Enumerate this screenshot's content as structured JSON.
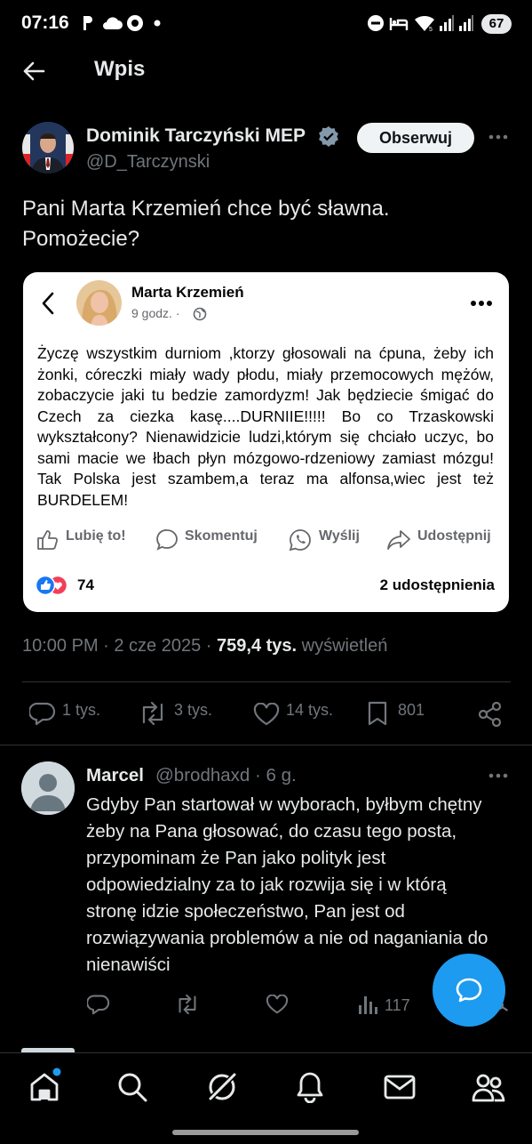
{
  "status_bar": {
    "time": "07:16",
    "battery": "67",
    "icons": [
      "p-icon",
      "cloud-icon",
      "chrome-icon",
      "dot-icon",
      "dnd-icon",
      "bed-icon",
      "wifi-icon",
      "signal-icon",
      "signal2-icon"
    ]
  },
  "header": {
    "title": "Wpis"
  },
  "post": {
    "author_name": "Dominik Tarczyński MEP",
    "author_handle": "@D_Tarczynski",
    "follow_label": "Obserwuj",
    "text_line1": "Pani Marta Krzemień chce być sławna.",
    "text_line2": "Pomożecie?",
    "timestamp": "10:00 PM · 2 cze 2025 · ",
    "views_count": "759,4 tys.",
    "views_label": " wyświetleń"
  },
  "embedded_card": {
    "author_name": "Marta Krzemień",
    "time": "9 godz. ·",
    "body": "Życzę wszystkim durniom ,ktorzy głosowali na ćpuna, żeby ich żonki, córeczki miały wady płodu, miały przemocowych mężów, zobaczycie jaki tu bedzie zamordyzm! Jak będziecie śmigać do Czech za ciezka kasę....DURNIIE!!!!! Bo co Trzaskowski wykształcony? Nienawidzicie ludzi,którym się chciało uczyc, bo sami macie we łbach płyn mózgowo-rdzeniowy zamiast mózgu! Tak Polska jest szambem,a teraz ma alfonsa,wiec jest też BURDELEM!",
    "actions": [
      "Lubię to!",
      "Skomentuj",
      "Wyślij",
      "Udostępnij"
    ],
    "reactions_count": "74",
    "shares": "2 udostępnienia"
  },
  "post_stats": {
    "replies": "1 tys.",
    "reposts": "3 tys.",
    "likes": "14 tys.",
    "bookmarks": "801"
  },
  "reply": {
    "author_name": "Marcel",
    "author_handle": "@brodhaxd · 6 g.",
    "text": "Gdyby Pan startował w wyborach, byłbym chętny żeby na Pana głosować, do czasu tego posta, przypominam że Pan jako polityk jest odpowiedzialny za to jak rozwija się i w którą stronę idzie społeczeństwo, Pan jest od rozwiązywania problemów a nie od naganiania do nienawiści",
    "views": "117"
  },
  "colors": {
    "background": "#000000",
    "accent": "#1d9bf0",
    "muted": "#71767b",
    "divider": "#2f3336",
    "like_heart": "#f33e58"
  }
}
